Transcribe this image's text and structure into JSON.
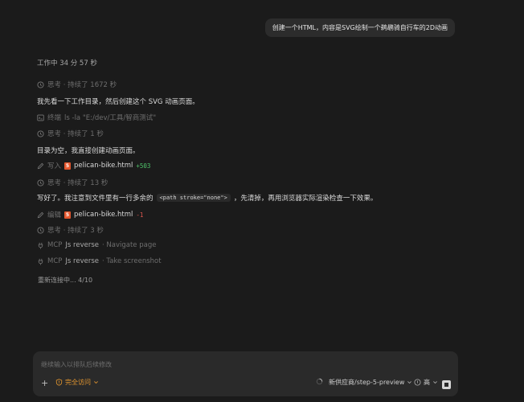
{
  "user_message": "创建一个HTML，内容是SVG绘制一个鹈鹕骑自行车的2D动画",
  "work_time": "工作中 34 分 57 秒",
  "steps": [
    {
      "type": "think",
      "label": "思考 · 持续了 1672 秒"
    },
    {
      "type": "text",
      "content": "我先看一下工作目录，然后创建这个 SVG 动画页面。"
    },
    {
      "type": "terminal",
      "label": "终端",
      "command": "ls -la \"E:/dev/工具/智商测试\""
    },
    {
      "type": "think",
      "label": "思考 · 持续了 1 秒"
    },
    {
      "type": "text",
      "content": "目录为空，我直接创建动画页面。"
    },
    {
      "type": "write",
      "label": "写入",
      "file": "pelican-bike.html",
      "diff": "+503"
    },
    {
      "type": "think",
      "label": "思考 · 持续了 13 秒"
    },
    {
      "type": "text_code",
      "before": "写好了。我注意到文件里有一行多余的",
      "code": "<path stroke=\"none\">",
      "after": "，先清掉，再用浏览器实际渲染检查一下效果。"
    },
    {
      "type": "edit",
      "label": "编辑",
      "file": "pelican-bike.html",
      "diff": "-1"
    },
    {
      "type": "think",
      "label": "思考 · 持续了 3 秒"
    },
    {
      "type": "mcp",
      "label": "MCP",
      "server": "Js reverse",
      "action": "· Navigate page"
    },
    {
      "type": "mcp",
      "label": "MCP",
      "server": "Js reverse",
      "action": "· Take screenshot"
    }
  ],
  "reconnect": "重新连接中... 4/10",
  "composer": {
    "placeholder": "继续输入以排队后续修改",
    "plus": "+",
    "access_label": "完全访问",
    "model": "新供应商/step-5-preview",
    "effort": "高"
  },
  "colors": {
    "background": "#1b1b1b",
    "accent_access": "#e1952f",
    "diff_add": "#4fc36a",
    "diff_remove": "#e0584f",
    "html_badge": "#e4572e"
  }
}
